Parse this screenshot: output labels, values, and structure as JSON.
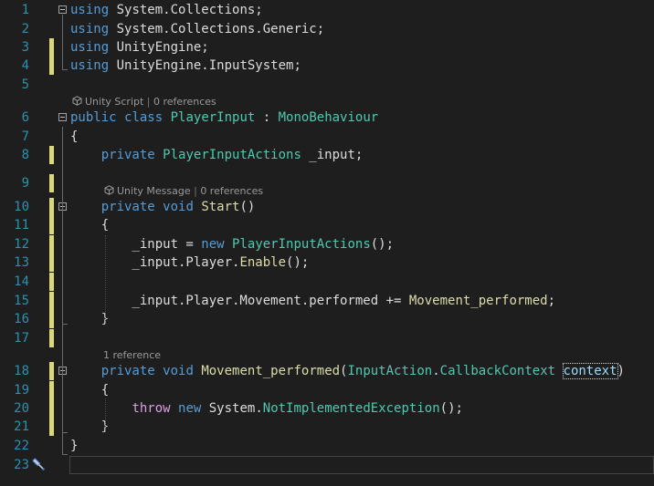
{
  "editor": {
    "lines": [
      {
        "num": "1",
        "segs": [
          {
            "c": "k",
            "t": "using"
          },
          {
            "c": "n",
            "t": " System.Collections;"
          }
        ]
      },
      {
        "num": "2",
        "segs": [
          {
            "c": "k",
            "t": "using"
          },
          {
            "c": "n",
            "t": " System.Collections.Generic;"
          }
        ]
      },
      {
        "num": "3",
        "segs": [
          {
            "c": "k",
            "t": "using"
          },
          {
            "c": "n",
            "t": " UnityEngine;"
          }
        ]
      },
      {
        "num": "4",
        "segs": [
          {
            "c": "k",
            "t": "using"
          },
          {
            "c": "n",
            "t": " UnityEngine.InputSystem;"
          }
        ]
      },
      {
        "num": "5",
        "segs": []
      },
      {
        "num": "6",
        "segs": [
          {
            "c": "k",
            "t": "public"
          },
          {
            "c": "n",
            "t": " "
          },
          {
            "c": "k",
            "t": "class"
          },
          {
            "c": "n",
            "t": " "
          },
          {
            "c": "t",
            "t": "PlayerInput"
          },
          {
            "c": "n",
            "t": " : "
          },
          {
            "c": "t",
            "t": "MonoBehaviour"
          }
        ]
      },
      {
        "num": "7",
        "segs": [
          {
            "c": "n",
            "t": "{"
          }
        ]
      },
      {
        "num": "8",
        "segs": [
          {
            "c": "n",
            "t": "    "
          },
          {
            "c": "k",
            "t": "private"
          },
          {
            "c": "n",
            "t": " "
          },
          {
            "c": "t",
            "t": "PlayerInputActions"
          },
          {
            "c": "n",
            "t": " _input;"
          }
        ]
      },
      {
        "num": "9",
        "segs": []
      },
      {
        "num": "10",
        "segs": [
          {
            "c": "n",
            "t": "    "
          },
          {
            "c": "k",
            "t": "private"
          },
          {
            "c": "n",
            "t": " "
          },
          {
            "c": "k",
            "t": "void"
          },
          {
            "c": "n",
            "t": " "
          },
          {
            "c": "m",
            "t": "Start"
          },
          {
            "c": "n",
            "t": "()"
          }
        ]
      },
      {
        "num": "11",
        "segs": [
          {
            "c": "n",
            "t": "    {"
          }
        ]
      },
      {
        "num": "12",
        "segs": [
          {
            "c": "n",
            "t": "        _input = "
          },
          {
            "c": "k",
            "t": "new"
          },
          {
            "c": "n",
            "t": " "
          },
          {
            "c": "t",
            "t": "PlayerInputActions"
          },
          {
            "c": "n",
            "t": "();"
          }
        ]
      },
      {
        "num": "13",
        "segs": [
          {
            "c": "n",
            "t": "        _input.Player."
          },
          {
            "c": "m",
            "t": "Enable"
          },
          {
            "c": "n",
            "t": "();"
          }
        ]
      },
      {
        "num": "14",
        "segs": []
      },
      {
        "num": "15",
        "segs": [
          {
            "c": "n",
            "t": "        _input.Player.Movement.performed += "
          },
          {
            "c": "m",
            "t": "Movement_performed"
          },
          {
            "c": "n",
            "t": ";"
          }
        ]
      },
      {
        "num": "16",
        "segs": [
          {
            "c": "n",
            "t": "    }"
          }
        ]
      },
      {
        "num": "17",
        "segs": []
      },
      {
        "num": "18",
        "segs": [
          {
            "c": "n",
            "t": "    "
          },
          {
            "c": "k",
            "t": "private"
          },
          {
            "c": "n",
            "t": " "
          },
          {
            "c": "k",
            "t": "void"
          },
          {
            "c": "n",
            "t": " "
          },
          {
            "c": "m",
            "t": "Movement_performed"
          },
          {
            "c": "n",
            "t": "("
          },
          {
            "c": "t",
            "t": "InputAction"
          },
          {
            "c": "n",
            "t": "."
          },
          {
            "c": "t",
            "t": "CallbackContext"
          },
          {
            "c": "n",
            "t": " "
          },
          {
            "c": "p ctx",
            "t": "context"
          },
          {
            "c": "n",
            "t": ")"
          }
        ]
      },
      {
        "num": "19",
        "segs": [
          {
            "c": "n",
            "t": "    {"
          }
        ]
      },
      {
        "num": "20",
        "segs": [
          {
            "c": "n",
            "t": "        "
          },
          {
            "c": "ck",
            "t": "throw"
          },
          {
            "c": "n",
            "t": " "
          },
          {
            "c": "k",
            "t": "new"
          },
          {
            "c": "n",
            "t": " System."
          },
          {
            "c": "t",
            "t": "NotImplementedException"
          },
          {
            "c": "n",
            "t": "();"
          }
        ]
      },
      {
        "num": "21",
        "segs": [
          {
            "c": "n",
            "t": "    }"
          }
        ]
      },
      {
        "num": "22",
        "segs": [
          {
            "c": "n",
            "t": "}"
          }
        ]
      },
      {
        "num": "23",
        "segs": []
      }
    ],
    "codelens": {
      "class": {
        "kind": "Unity Script",
        "refs": "0 references",
        "icon": "unity-icon"
      },
      "start": {
        "kind": "Unity Message",
        "refs": "0 references",
        "icon": "unity-icon"
      },
      "movement": {
        "refs": "1 reference"
      }
    },
    "colors": {
      "background": "#1e1e1e",
      "line_number": "#2b91af",
      "keyword": "#569cd6",
      "control_keyword": "#d8a0df",
      "type": "#4ec9b0",
      "method": "#dcdcaa",
      "parameter": "#9cdcfe",
      "change_bar": "#d9d97a"
    }
  }
}
